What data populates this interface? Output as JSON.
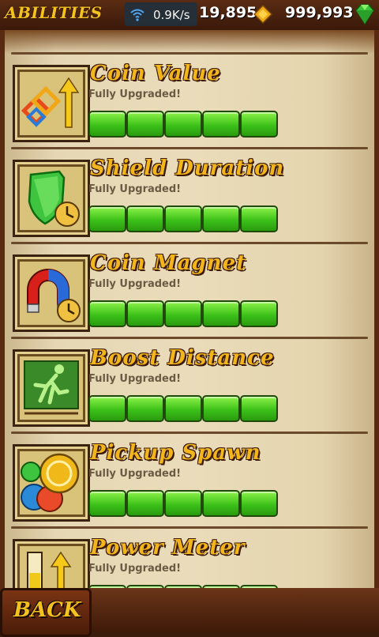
{
  "header": {
    "title": "ABILITIES",
    "network": "0.9K/s",
    "coins": "19,895",
    "gems": "999,993"
  },
  "abilities": [
    {
      "title": "Coin Value",
      "status": "Fully Upgraded!",
      "level": 5,
      "max_level": 5
    },
    {
      "title": "Shield Duration",
      "status": "Fully Upgraded!",
      "level": 5,
      "max_level": 5
    },
    {
      "title": "Coin Magnet",
      "status": "Fully Upgraded!",
      "level": 5,
      "max_level": 5
    },
    {
      "title": "Boost Distance",
      "status": "Fully Upgraded!",
      "level": 5,
      "max_level": 5
    },
    {
      "title": "Pickup Spawn",
      "status": "Fully Upgraded!",
      "level": 5,
      "max_level": 5
    },
    {
      "title": "Power Meter",
      "status": "Fully Upgraded!",
      "level": 5,
      "max_level": 5
    }
  ],
  "footer": {
    "back_label": "BACK"
  },
  "colors": {
    "title_gold": "#f3b51c",
    "bar_green": "#3cc21a",
    "parchment": "#e6d7b4"
  }
}
